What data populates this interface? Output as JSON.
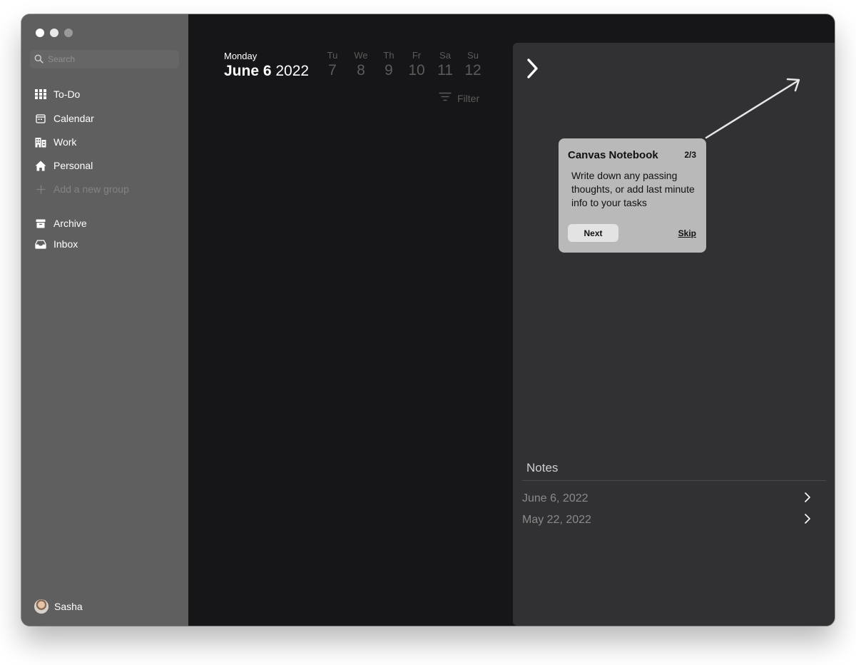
{
  "window": {
    "traffic_lights": [
      "#ffffff",
      "#e8e8e8",
      "#9a9a9a"
    ]
  },
  "sidebar": {
    "search": {
      "placeholder": "Search",
      "icon": "search-icon"
    },
    "items": [
      {
        "label": "To-Do",
        "icon": "grid-icon"
      },
      {
        "label": "Calendar",
        "icon": "calendar-icon"
      },
      {
        "label": "Work",
        "icon": "building-icon"
      },
      {
        "label": "Personal",
        "icon": "home-icon"
      },
      {
        "label": "Add a new group",
        "icon": "plus-icon"
      },
      {
        "label": "Archive",
        "icon": "archive-icon"
      },
      {
        "label": "Inbox",
        "icon": "inbox-icon"
      }
    ],
    "user": {
      "name": "Sasha"
    }
  },
  "header": {
    "weekday": "Monday",
    "date_bold": "June 6",
    "year": "2022",
    "days": [
      {
        "name": "Tu",
        "num": "7"
      },
      {
        "name": "We",
        "num": "8"
      },
      {
        "name": "Th",
        "num": "9"
      },
      {
        "name": "Fr",
        "num": "10"
      },
      {
        "name": "Sa",
        "num": "11"
      },
      {
        "name": "Su",
        "num": "12"
      }
    ],
    "filter_label": "Filter"
  },
  "panel": {
    "notes_title": "Notes",
    "notes": [
      {
        "date": "June 6, 2022"
      },
      {
        "date": "May 22, 2022"
      }
    ]
  },
  "tour": {
    "title": "Canvas Notebook",
    "step": "2/3",
    "body": "Write down any passing thoughts, or add last minute info to your tasks",
    "next_label": "Next",
    "skip_label": "Skip"
  },
  "colors": {
    "sidebar_bg": "#5f5f5f",
    "main_bg": "#161618",
    "panel_bg": "#313133",
    "tour_bg": "#b9b9b9",
    "muted_text": "#5b5b5b"
  }
}
